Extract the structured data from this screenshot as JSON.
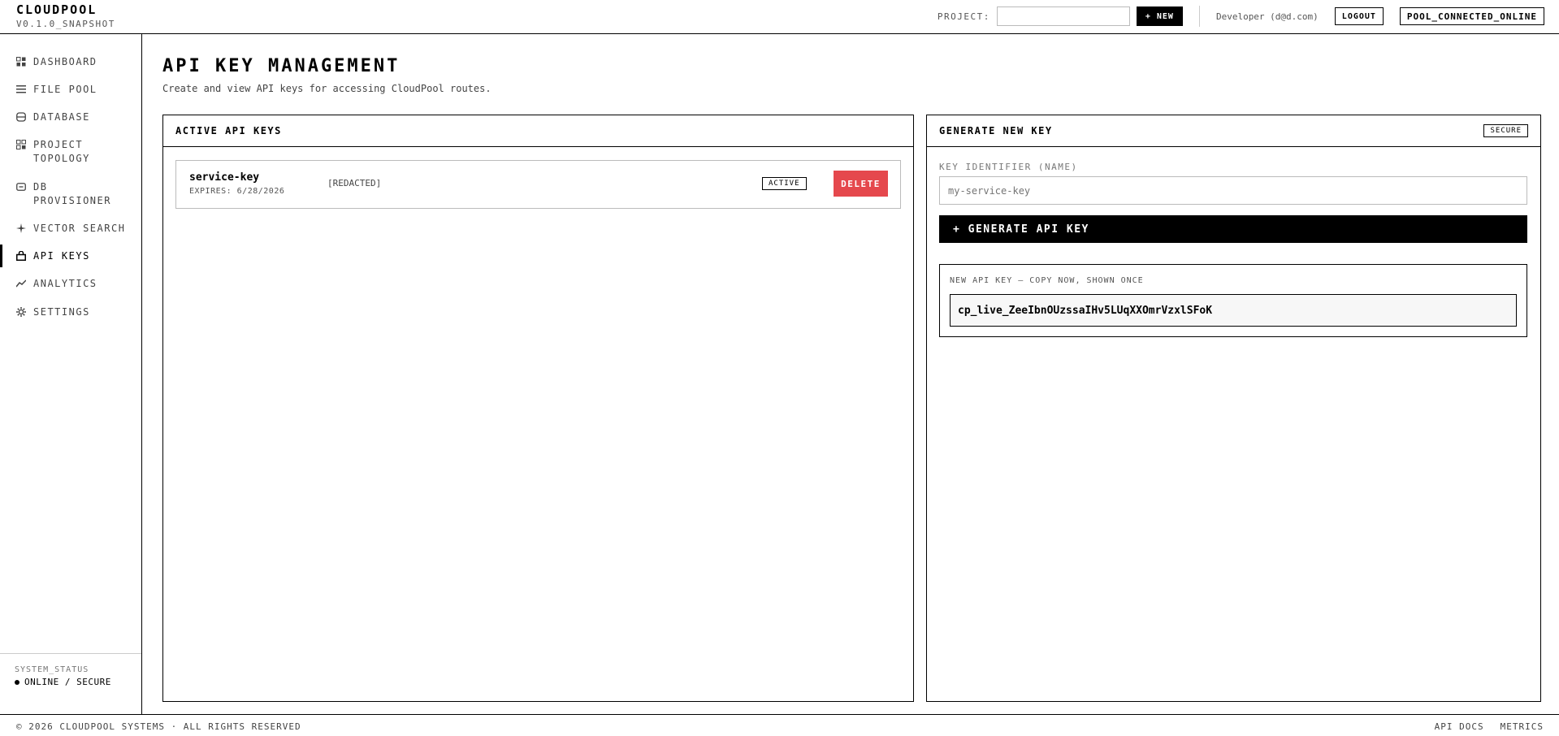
{
  "header": {
    "brand": "CLOUDPOOL",
    "version": "V0.1.0_SNAPSHOT",
    "project_label": "PROJECT:",
    "project_value": "",
    "new_label": "+ NEW",
    "user": "Developer (d@d.com)",
    "logout_label": "LOGOUT",
    "status_label": "POOL_CONNECTED_ONLINE"
  },
  "sidebar": {
    "items": [
      {
        "label": "DASHBOARD",
        "icon": "grid-icon"
      },
      {
        "label": "FILE POOL",
        "icon": "list-icon"
      },
      {
        "label": "DATABASE",
        "icon": "database-icon"
      },
      {
        "label": "PROJECT\nTOPOLOGY",
        "icon": "topology-icon"
      },
      {
        "label": "DB\nPROVISIONER",
        "icon": "provisioner-icon"
      },
      {
        "label": "VECTOR SEARCH",
        "icon": "sparkle-icon"
      },
      {
        "label": "API KEYS",
        "icon": "lock-icon"
      },
      {
        "label": "ANALYTICS",
        "icon": "chart-line-icon"
      },
      {
        "label": "SETTINGS",
        "icon": "gear-icon"
      }
    ],
    "active": "API KEYS",
    "system_status_title": "SYSTEM_STATUS",
    "system_status_value": "ONLINE / SECURE"
  },
  "main": {
    "title": "API KEY MANAGEMENT",
    "subtitle": "Create and view API keys for accessing CloudPool routes.",
    "active_panel": {
      "title": "ACTIVE API KEYS",
      "keys": [
        {
          "name": "service-key",
          "expires": "EXPIRES: 6/28/2026",
          "value": "[REDACTED]",
          "status": "ACTIVE",
          "delete_label": "DELETE"
        }
      ]
    },
    "generate_panel": {
      "title": "GENERATE NEW KEY",
      "badge": "SECURE",
      "field_label": "KEY IDENTIFIER (NAME)",
      "field_placeholder": "my-service-key",
      "generate_label": "+ GENERATE API KEY",
      "new_key_label": "NEW API KEY — COPY NOW, SHOWN ONCE",
      "new_key_value": "cp_live_ZeeIbnOUzssaIHv5LUqXXOmrVzxlSFoK"
    }
  },
  "footer": {
    "copyright": "© 2026 CLOUDPOOL SYSTEMS · ALL RIGHTS RESERVED",
    "links": [
      "API DOCS",
      "METRICS"
    ]
  }
}
